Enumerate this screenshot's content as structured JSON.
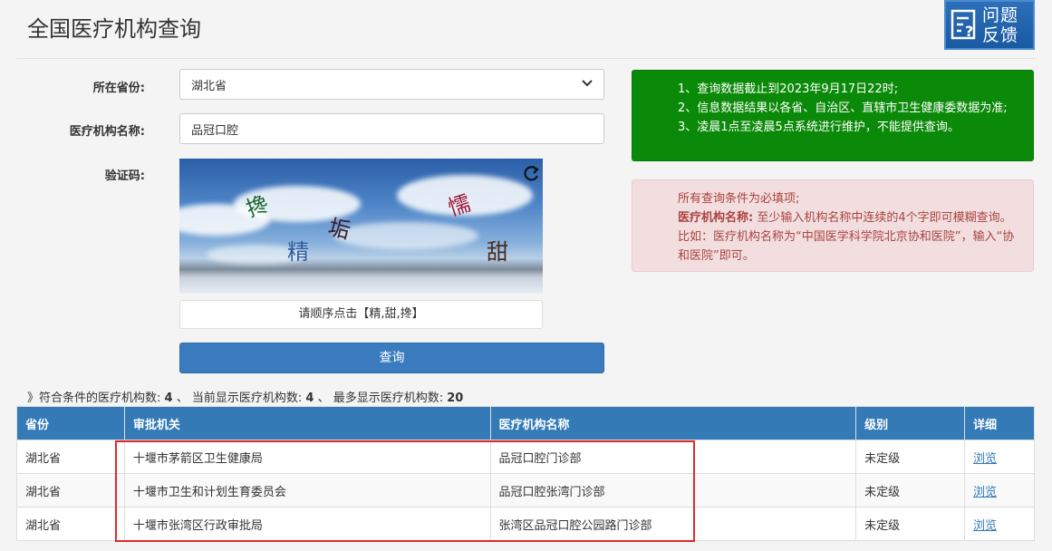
{
  "page": {
    "title": "全国医疗机构查询"
  },
  "feedback": {
    "label_line1": "问题",
    "label_line2": "反馈"
  },
  "form": {
    "province_label": "所在省份:",
    "province_value": "湖北省",
    "name_label": "医疗机构名称:",
    "name_value": "品冠口腔",
    "captcha_label": "验证码:",
    "captcha_chars": [
      "搀",
      "垢",
      "精",
      "懦",
      "甜"
    ],
    "captcha_hint": "请顺序点击【精,甜,搀】",
    "submit_label": "查询"
  },
  "notice_green": {
    "lines": [
      "1、查询数据截止到2023年9月17日22时;",
      "2、信息数据结果以各省、自治区、直辖市卫生健康委数据为准;",
      "3、凌晨1点至凌晨5点系统进行维护，不能提供查询。"
    ]
  },
  "notice_red": {
    "line1": "所有查询条件为必填项;",
    "bold_label": "医疗机构名称:",
    "detail": "至少输入机构名称中连续的4个字即可模糊查询。比如：医疗机构名称为“中国医学科学院北京协和医院”，输入“协和医院”即可。"
  },
  "summary": {
    "prefix": "》符合条件的医疗机构数:",
    "total": "4",
    "sep1": "、 当前显示医疗机构数:",
    "shown": "4",
    "sep2": "、 最多显示医疗机构数:",
    "max": "20"
  },
  "table": {
    "headers": [
      "省份",
      "审批机关",
      "医疗机构名称",
      "级别",
      "详细"
    ],
    "rows": [
      [
        "湖北省",
        "十堰市茅箭区卫生健康局",
        "品冠口腔门诊部",
        "未定级",
        "浏览"
      ],
      [
        "湖北省",
        "十堰市卫生和计划生育委员会",
        "品冠口腔张湾门诊部",
        "未定级",
        "浏览"
      ],
      [
        "湖北省",
        "十堰市张湾区行政审批局",
        "张湾区品冠口腔公园路门诊部",
        "未定级",
        "浏览"
      ]
    ]
  },
  "colors": {
    "primary": "#337ab7",
    "notice_green": "#0b8a09",
    "notice_red_bg": "#f2dede",
    "highlight": "#e02a2a"
  }
}
